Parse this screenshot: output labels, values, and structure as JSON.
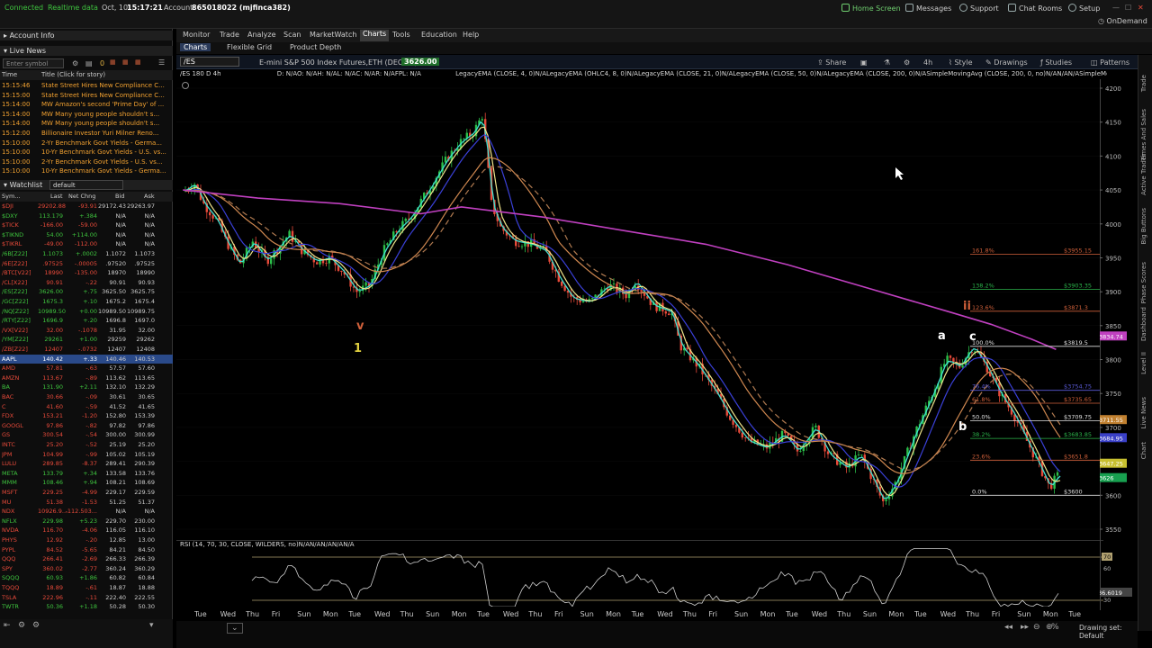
{
  "topbar": {
    "connected": "Connected",
    "realtime": "Realtime data",
    "date": "Oct, 10",
    "time": "15:17:21",
    "account_label": "Account:",
    "account_value": "865018022 (mjfinca382)",
    "home_screen": "Home Screen",
    "messages": "Messages",
    "support": "Support",
    "chat_rooms": "Chat Rooms",
    "setup": "Setup",
    "ondemand": "OnDemand"
  },
  "left": {
    "account_info": "Account Info",
    "live_news": "Live News",
    "enter_symbol_placeholder": "Enter symbol",
    "news_zero": "0",
    "news_headers": [
      "Time",
      "Title (Click for story)"
    ],
    "news": [
      {
        "time": "15:15:46",
        "title": "State Street Hires New Compliance C..."
      },
      {
        "time": "15:15:00",
        "title": "State Street Hires New Compliance C..."
      },
      {
        "time": "15:14:00",
        "title": "MW Amazon's second 'Prime Day' of ..."
      },
      {
        "time": "15:14:00",
        "title": "MW Many young people shouldn't s..."
      },
      {
        "time": "15:14:00",
        "title": "MW Many young people shouldn't s..."
      },
      {
        "time": "15:12:00",
        "title": "Billionaire Investor Yuri Milner Reno..."
      },
      {
        "time": "15:10:00",
        "title": "2-Yr Benchmark Govt Yields - Germa..."
      },
      {
        "time": "15:10:00",
        "title": "10-Yr Benchmark Govt Yields - U.S. vs..."
      },
      {
        "time": "15:10:00",
        "title": "2-Yr Benchmark Govt Yields - U.S. vs..."
      },
      {
        "time": "15:10:00",
        "title": "10-Yr Benchmark Govt Yields - Germa..."
      }
    ],
    "watchlist_label": "Watchlist",
    "watchlist_name": "default",
    "watch_headers": [
      "Sym...",
      "Last",
      "Net Chng",
      "Bid",
      "Ask"
    ],
    "watch": [
      {
        "sym": "$DJI",
        "last": "29202.88",
        "chg": "-93.91",
        "bid": "29172.43",
        "ask": "29263.97",
        "color": "#e84a3a"
      },
      {
        "sym": "$DXY",
        "last": "113.179",
        "chg": "+.384",
        "bid": "N/A",
        "ask": "N/A",
        "color": "#3ec43e"
      },
      {
        "sym": "$TICK",
        "last": "-166.00",
        "chg": "-59.00",
        "bid": "N/A",
        "ask": "N/A",
        "color": "#e84a3a"
      },
      {
        "sym": "$TIKND",
        "last": "54.00",
        "chg": "+114.00",
        "bid": "N/A",
        "ask": "N/A",
        "color": "#3ec43e"
      },
      {
        "sym": "$TIKRL",
        "last": "-49.00",
        "chg": "-112.00",
        "bid": "N/A",
        "ask": "N/A",
        "color": "#e84a3a"
      },
      {
        "sym": "/6B[Z22]",
        "last": "1.1073",
        "chg": "+.0002",
        "bid": "1.1072",
        "ask": "1.1073",
        "color": "#3ec43e"
      },
      {
        "sym": "/6E[Z22]",
        "last": ".97525",
        "chg": "-.00005",
        "bid": ".97520",
        "ask": ".97525",
        "color": "#e84a3a"
      },
      {
        "sym": "/BTC[V22]",
        "last": "18990",
        "chg": "-135.00",
        "bid": "18970",
        "ask": "18990",
        "color": "#e84a3a"
      },
      {
        "sym": "/CL[X22]",
        "last": "90.91",
        "chg": "-.22",
        "bid": "90.91",
        "ask": "90.93",
        "color": "#e84a3a"
      },
      {
        "sym": "/ES[Z22]",
        "last": "3626.00",
        "chg": "+.75",
        "bid": "3625.50",
        "ask": "3625.75",
        "color": "#3ec43e"
      },
      {
        "sym": "/GC[Z22]",
        "last": "1675.3",
        "chg": "+.10",
        "bid": "1675.2",
        "ask": "1675.4",
        "color": "#3ec43e"
      },
      {
        "sym": "/NQ[Z22]",
        "last": "10989.50",
        "chg": "+0.00",
        "bid": "10989.50",
        "ask": "10989.75",
        "color": "#3ec43e"
      },
      {
        "sym": "/RTY[Z22]",
        "last": "1696.9",
        "chg": "+.20",
        "bid": "1696.8",
        "ask": "1697.0",
        "color": "#3ec43e"
      },
      {
        "sym": "/VX[V22]",
        "last": "32.00",
        "chg": "-.1078",
        "bid": "31.95",
        "ask": "32.00",
        "color": "#e84a3a"
      },
      {
        "sym": "/YM[Z22]",
        "last": "29261",
        "chg": "+1.00",
        "bid": "29259",
        "ask": "29262",
        "color": "#3ec43e"
      },
      {
        "sym": "/ZB[Z22]",
        "last": "12407",
        "chg": "-.0732",
        "bid": "12407",
        "ask": "12408",
        "color": "#e84a3a"
      },
      {
        "sym": "AAPL",
        "last": "140.42",
        "chg": "+.33",
        "bid": "140.46",
        "ask": "140.53",
        "color": "#ffffff",
        "selected": true
      },
      {
        "sym": "AMD",
        "last": "57.81",
        "chg": "-.63",
        "bid": "57.57",
        "ask": "57.60",
        "color": "#e84a3a"
      },
      {
        "sym": "AMZN",
        "last": "113.67",
        "chg": "-.89",
        "bid": "113.62",
        "ask": "113.65",
        "color": "#e84a3a"
      },
      {
        "sym": "BA",
        "last": "131.90",
        "chg": "+2.11",
        "bid": "132.10",
        "ask": "132.29",
        "color": "#3ec43e"
      },
      {
        "sym": "BAC",
        "last": "30.66",
        "chg": "-.09",
        "bid": "30.61",
        "ask": "30.65",
        "color": "#e84a3a"
      },
      {
        "sym": "C",
        "last": "41.60",
        "chg": "-.59",
        "bid": "41.52",
        "ask": "41.65",
        "color": "#e84a3a"
      },
      {
        "sym": "FDX",
        "last": "153.21",
        "chg": "-1.20",
        "bid": "152.80",
        "ask": "153.39",
        "color": "#e84a3a"
      },
      {
        "sym": "GOOGL",
        "last": "97.86",
        "chg": "-.82",
        "bid": "97.82",
        "ask": "97.86",
        "color": "#e84a3a"
      },
      {
        "sym": "GS",
        "last": "300.54",
        "chg": "-.54",
        "bid": "300.00",
        "ask": "300.99",
        "color": "#e84a3a"
      },
      {
        "sym": "INTC",
        "last": "25.20",
        "chg": "-.52",
        "bid": "25.19",
        "ask": "25.20",
        "color": "#e84a3a"
      },
      {
        "sym": "JPM",
        "last": "104.99",
        "chg": "-.99",
        "bid": "105.02",
        "ask": "105.19",
        "color": "#e84a3a"
      },
      {
        "sym": "LULU",
        "last": "289.85",
        "chg": "-8.37",
        "bid": "289.41",
        "ask": "290.39",
        "color": "#e84a3a"
      },
      {
        "sym": "META",
        "last": "133.79",
        "chg": "+.34",
        "bid": "133.58",
        "ask": "133.76",
        "color": "#3ec43e"
      },
      {
        "sym": "MMM",
        "last": "108.46",
        "chg": "+.94",
        "bid": "108.21",
        "ask": "108.69",
        "color": "#3ec43e"
      },
      {
        "sym": "MSFT",
        "last": "229.25",
        "chg": "-4.99",
        "bid": "229.17",
        "ask": "229.59",
        "color": "#e84a3a"
      },
      {
        "sym": "MU",
        "last": "51.38",
        "chg": "-1.53",
        "bid": "51.25",
        "ask": "51.37",
        "color": "#e84a3a"
      },
      {
        "sym": "NDX",
        "last": "10926.9...",
        "chg": "-112.503...",
        "bid": "N/A",
        "ask": "N/A",
        "color": "#e84a3a"
      },
      {
        "sym": "NFLX",
        "last": "229.98",
        "chg": "+5.23",
        "bid": "229.70",
        "ask": "230.00",
        "color": "#3ec43e"
      },
      {
        "sym": "NVDA",
        "last": "116.70",
        "chg": "-4.06",
        "bid": "116.05",
        "ask": "116.10",
        "color": "#e84a3a"
      },
      {
        "sym": "PHYS",
        "last": "12.92",
        "chg": "-.20",
        "bid": "12.85",
        "ask": "13.00",
        "color": "#e84a3a"
      },
      {
        "sym": "PYPL",
        "last": "84.52",
        "chg": "-5.65",
        "bid": "84.21",
        "ask": "84.50",
        "color": "#e84a3a"
      },
      {
        "sym": "QQQ",
        "last": "266.41",
        "chg": "-2.69",
        "bid": "266.33",
        "ask": "266.39",
        "color": "#e84a3a"
      },
      {
        "sym": "SPY",
        "last": "360.02",
        "chg": "-2.77",
        "bid": "360.24",
        "ask": "360.29",
        "color": "#e84a3a"
      },
      {
        "sym": "SQQQ",
        "last": "60.93",
        "chg": "+1.86",
        "bid": "60.82",
        "ask": "60.84",
        "color": "#3ec43e"
      },
      {
        "sym": "TQQQ",
        "last": "18.89",
        "chg": "-.61",
        "bid": "18.87",
        "ask": "18.88",
        "color": "#e84a3a"
      },
      {
        "sym": "TSLA",
        "last": "222.96",
        "chg": "-.11",
        "bid": "222.40",
        "ask": "222.55",
        "color": "#e84a3a"
      },
      {
        "sym": "TWTR",
        "last": "50.36",
        "chg": "+1.18",
        "bid": "50.28",
        "ask": "50.30",
        "color": "#3ec43e"
      }
    ]
  },
  "nav": {
    "tabs": [
      "Monitor",
      "Trade",
      "Analyze",
      "Scan",
      "MarketWatch",
      "Charts",
      "Tools",
      "Education",
      "Help"
    ],
    "active_tab": "Charts",
    "subtabs": [
      "Charts",
      "Flexible Grid",
      "Product Depth"
    ]
  },
  "chartbar": {
    "symbol": "/ES",
    "description": "E-mini S&P 500 Index Futures,ETH (DEC 22)",
    "price": "3626.00",
    "share": "Share",
    "timeframe": "4h",
    "style": "Style",
    "drawings": "Drawings",
    "studies": "Studies",
    "patterns": "Patterns"
  },
  "chart": {
    "period_label": "/ES 180 D 4h",
    "info_text": "D: N/AO: N/AH: N/AL: N/AC: N/AR: N/AFPL: N/A",
    "study_text": "LegacyEMA (CLOSE, 4, 0)N/ALegacyEMA (OHLC4, 8, 0)N/ALegacyEMA (CLOSE, 21, 0)N/ALegacyEMA (CLOSE, 50, 0)N/ALegacyEMA (CLOSE, 200, 0)N/ASimpleMovingAvg (CLOSE, 200, 0, no)N/AN/AN/ASimpleMoving...",
    "price_axis": [
      "4200",
      "4150",
      "4100",
      "4050",
      "4000",
      "3950",
      "3900",
      "3850",
      "3800",
      "3750",
      "3700",
      "3650",
      "3600",
      "3550"
    ],
    "price_min": 3550,
    "price_max": 4200,
    "fib_levels": [
      {
        "pct": "161.8%",
        "price": "$3955.15",
        "color": "#d0603a"
      },
      {
        "pct": "138.2%",
        "price": "$3903.35",
        "color": "#2bb34a"
      },
      {
        "pct": "123.6%",
        "price": "$3871.3",
        "color": "#d0603a"
      },
      {
        "pct": "100.0%",
        "price": "$3819.5",
        "color": "#e0e0e0"
      },
      {
        "pct": "76.4%",
        "price": "$3754.75",
        "color": "#5a5ad8"
      },
      {
        "pct": "61.8%",
        "price": "$3735.65",
        "color": "#d0603a"
      },
      {
        "pct": "50.0%",
        "price": "$3709.75",
        "color": "#e0e0e0"
      },
      {
        "pct": "38.2%",
        "price": "$3683.85",
        "color": "#2bb34a"
      },
      {
        "pct": "23.6%",
        "price": "$3651.8",
        "color": "#d0603a"
      },
      {
        "pct": "0.0%",
        "price": "$3600",
        "color": "#e0e0e0"
      }
    ],
    "axis_badges": [
      {
        "price": "3834.74",
        "color": "#c040c0"
      },
      {
        "price": "3711.55",
        "color": "#c08030"
      },
      {
        "price": "3684.95",
        "color": "#3a40c8"
      },
      {
        "price": "3647.25",
        "color": "#c8c030"
      },
      {
        "price": "3626",
        "color": "#18a050"
      }
    ],
    "wave_labels": [
      {
        "text": "v",
        "color": "#d0603a"
      },
      {
        "text": "1",
        "color": "#e0d040"
      },
      {
        "text": "a",
        "color": "#ffffff"
      },
      {
        "text": "b",
        "color": "#ffffff"
      },
      {
        "text": "c",
        "color": "#ffffff"
      },
      {
        "text": "ii",
        "color": "#d0603a"
      }
    ],
    "time_labels": [
      "Tue",
      "Wed",
      "Thu",
      "Fri",
      "Sun",
      "Mon",
      "Tue",
      "Wed",
      "Thu",
      "Sun",
      "Mon",
      "Tue",
      "Wed",
      "Thu",
      "Fri",
      "Sun",
      "Mon",
      "Tue",
      "Wed",
      "Thu",
      "Fri",
      "Sun",
      "Mon",
      "Tue",
      "Wed",
      "Thu",
      "Sun",
      "Mon",
      "Tue",
      "Wed",
      "Thu",
      "Fri",
      "Sun",
      "Mon",
      "Tue"
    ]
  },
  "rsi": {
    "label": "RSI (14, 70, 30, CLOSE, WILDERS, no)N/AN/AN/AN/AN/A",
    "axis": [
      "70",
      "60",
      "30"
    ],
    "value": "36.6019"
  },
  "vstrip": [
    "Trade",
    "Times And Sales",
    "Active Trader",
    "Big Buttons",
    "Phase Scores",
    "Dashboard",
    "Level II",
    "Live News",
    "Chart"
  ],
  "bottom": {
    "drawing_set": "Drawing set: Default"
  }
}
